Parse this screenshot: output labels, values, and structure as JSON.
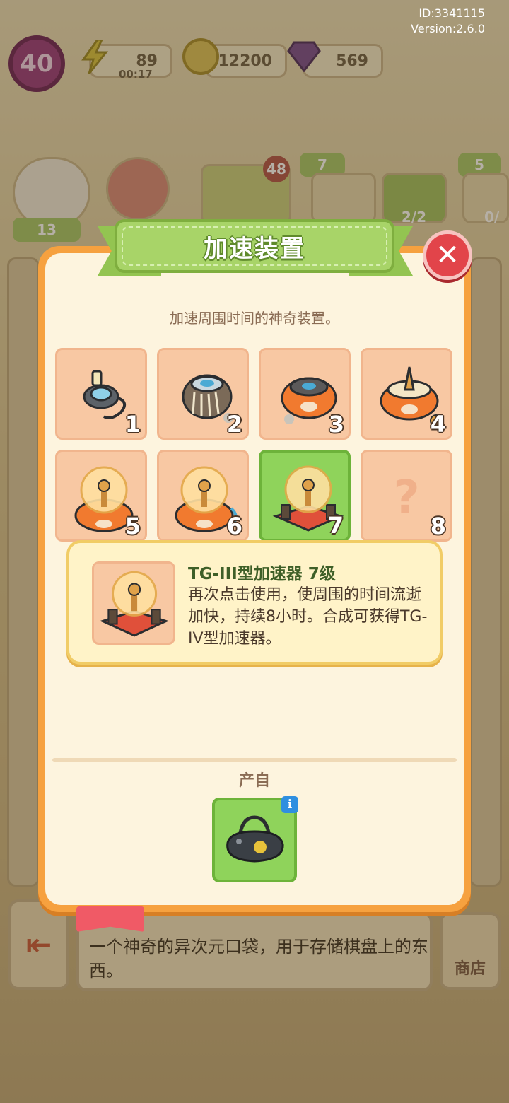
{
  "meta": {
    "id_text": "ID:3341115",
    "version_text": "Version:2.6.0"
  },
  "hud": {
    "level": "40",
    "energy": "89",
    "energy_timer": "00:17",
    "coins": "12200",
    "gems": "569"
  },
  "background": {
    "badge_13": "13",
    "badge_48": "48",
    "badge_7": "7",
    "badge_5": "5",
    "progress_2_2": "2/2",
    "progress_0": "0/",
    "description": "一个神奇的异次元口袋，用于存储棋盘上的东西。",
    "shop_label": "商店"
  },
  "dialog": {
    "title": "加速装置",
    "subtitle": "加速周围时间的神奇装置。",
    "levels": [
      {
        "num": "1",
        "state": "unlocked"
      },
      {
        "num": "2",
        "state": "unlocked"
      },
      {
        "num": "3",
        "state": "unlocked"
      },
      {
        "num": "4",
        "state": "unlocked"
      },
      {
        "num": "5",
        "state": "unlocked"
      },
      {
        "num": "6",
        "state": "unlocked"
      },
      {
        "num": "7",
        "state": "selected"
      },
      {
        "num": "8",
        "state": "locked",
        "placeholder": "?"
      }
    ],
    "info": {
      "title": "TG-III型加速器  7级",
      "description": "再次点击使用，使周围的时间流逝加快，持续8小时。合成可获得TG-IV型加速器。"
    },
    "source_label": "产自",
    "source_info_glyph": "i"
  },
  "colors": {
    "dialog_border": "#f6a13f",
    "dialog_bg": "#fdf4de",
    "title_green": "#a8d468",
    "cell_bg": "#f8c8a3",
    "selected_green": "#8fd35b",
    "close_red": "#e2444a"
  }
}
